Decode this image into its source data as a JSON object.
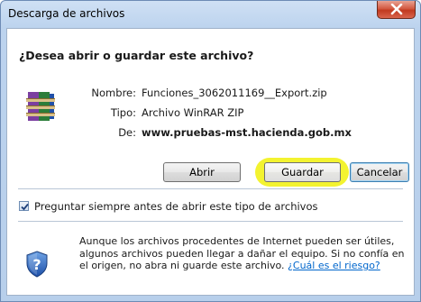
{
  "window": {
    "title": "Descarga de archivos"
  },
  "dialog": {
    "heading": "¿Desea abrir o guardar este archivo?",
    "file": {
      "name_label": "Nombre:",
      "name_value": "Funciones_3062011169__Export.zip",
      "type_label": "Tipo:",
      "type_value": "Archivo WinRAR ZIP",
      "from_label": "De:",
      "from_value": "www.pruebas-mst.hacienda.gob.mx",
      "icon": "winrar-archive-icon"
    },
    "buttons": {
      "open": "Abrir",
      "save": "Guardar",
      "cancel": "Cancelar"
    },
    "checkbox": {
      "label": "Preguntar siempre antes de abrir este tipo de archivos",
      "checked": true
    },
    "warning": {
      "text": "Aunque los archivos procedentes de Internet pueden ser útiles, algunos archivos pueden llegar a dañar el equipo. Si no confía en el origen, no abra ni guarde este archivo.",
      "link": "¿Cuál es el riesgo?",
      "icon": "security-shield-icon"
    }
  },
  "colors": {
    "highlight": "#f2f21a",
    "link": "#0066cc",
    "close": "#c0391f"
  }
}
